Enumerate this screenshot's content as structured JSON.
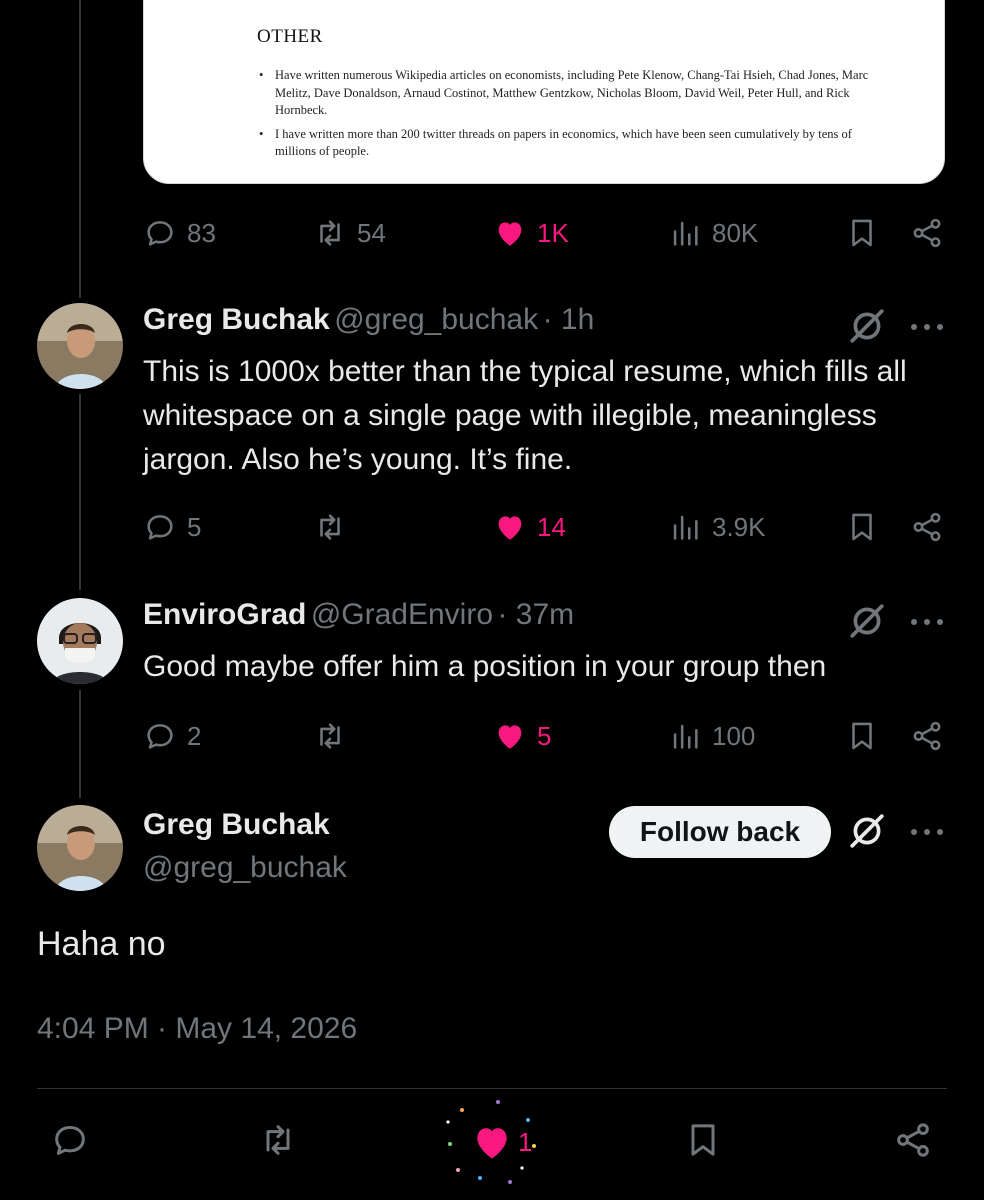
{
  "embedded_doc": {
    "heading": "OTHER",
    "items": [
      "Have written numerous Wikipedia articles on economists, including Pete Klenow, Chang-Tai Hsieh, Chad Jones, Marc Melitz, Dave Donaldson, Arnaud Costinot, Matthew Gentzkow, Nicholas Bloom, David Weil, Peter Hull, and Rick Hornbeck.",
      "I have written more than 200 twitter threads on papers in economics, which have been seen cumulatively by tens of millions of people."
    ]
  },
  "main_post_stats": {
    "replies": "83",
    "reposts": "54",
    "likes": "1K",
    "views": "80K"
  },
  "replies": [
    {
      "name": "Greg Buchak",
      "handle": "@greg_buchak",
      "time": "· 1h",
      "text": "This is 1000x better than the typical resume, which fills all whitespace on a single page with illegible, meaningless jargon. Also he’s young. It’s fine.",
      "stats": {
        "replies": "5",
        "reposts": "",
        "likes": "14",
        "views": "3.9K"
      }
    },
    {
      "name": "EnviroGrad",
      "handle": "@GradEnviro",
      "time": "· 37m",
      "text": "Good maybe offer him a position in your group then",
      "stats": {
        "replies": "2",
        "reposts": "",
        "likes": "5",
        "views": "100"
      }
    }
  ],
  "focused_post": {
    "name": "Greg Buchak",
    "handle": "@greg_buchak",
    "follow_label": "Follow back",
    "text": "Haha no",
    "timestamp": "4:04 PM · May 14, 2026",
    "likes": "1"
  },
  "colors": {
    "like": "#f91880",
    "muted": "#71767b",
    "background": "#000000"
  },
  "icons": [
    "reply-icon",
    "repost-icon",
    "like-icon",
    "views-icon",
    "bookmark-icon",
    "share-icon",
    "grok-icon",
    "more-icon"
  ]
}
